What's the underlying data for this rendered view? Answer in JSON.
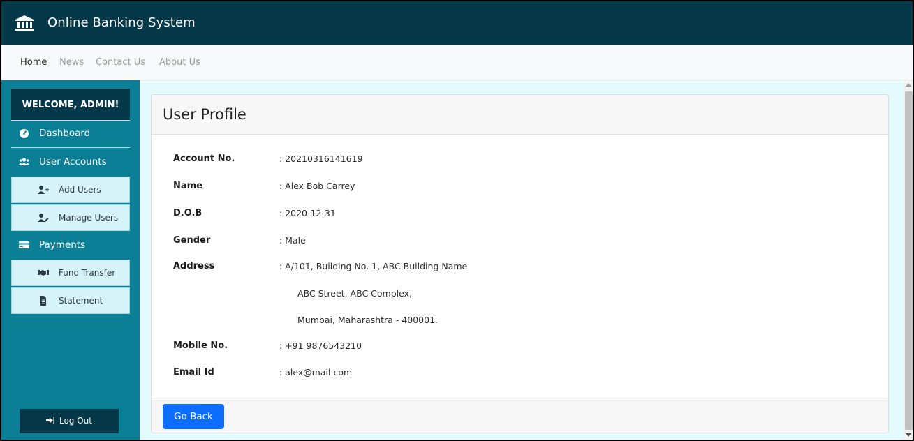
{
  "header": {
    "title": "Online Banking System",
    "icon": "bank-icon"
  },
  "nav": {
    "links": [
      "Home",
      "News",
      "Contact Us",
      "About Us"
    ],
    "active": "Home"
  },
  "sidebar": {
    "welcome": "WELCOME, ADMIN!",
    "items": [
      {
        "label": "Dashboard",
        "icon": "dashboard-icon"
      },
      {
        "label": "User Accounts",
        "icon": "users-icon"
      },
      {
        "label": "Add Users",
        "icon": "user-plus-icon"
      },
      {
        "label": "Manage Users",
        "icon": "user-edit-icon"
      },
      {
        "label": "Payments",
        "icon": "credit-card-icon"
      },
      {
        "label": "Fund Transfer",
        "icon": "handshake-icon"
      },
      {
        "label": "Statement",
        "icon": "file-icon"
      }
    ],
    "logout": "Log Out"
  },
  "profile": {
    "title": "User Profile",
    "fields": [
      {
        "label": "Account No.",
        "value": ": 20210316141619"
      },
      {
        "label": "Name",
        "value": ": Alex Bob Carrey"
      },
      {
        "label": "D.O.B",
        "value": ": 2020-12-31"
      },
      {
        "label": "Gender",
        "value": ": Male"
      },
      {
        "label": "Address",
        "value": ": A/101, Building No. 1, ABC Building Name"
      },
      {
        "label": "Mobile No.",
        "value": ": +91 9876543210"
      },
      {
        "label": "Email Id",
        "value": ": alex@mail.com"
      }
    ],
    "address_lines": [
      "ABC Street, ABC Complex,",
      "Mumbai,  Maharashtra - 400001."
    ],
    "back_button": "Go Back"
  },
  "colors": {
    "header": "#05394a",
    "sidebar": "#0a7f96",
    "submenu": "#d6f3f9",
    "content_bg": "#e3fbfd",
    "primary": "#0d6efd"
  }
}
